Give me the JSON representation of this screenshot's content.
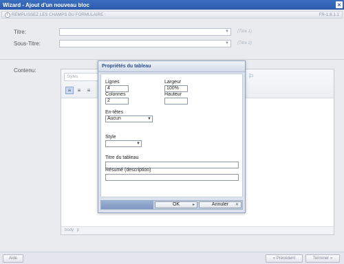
{
  "window": {
    "title": "Wizard - Ajout d'un nouveau bloc",
    "close_icon": "close-icon"
  },
  "strip": {
    "text": "REMPLISSEZ LES CHAMPS DU FORMULAIRE :",
    "version": "FR-1.8.1.1",
    "icon": "info-icon"
  },
  "form": {
    "titre_label": "Titre:",
    "titre_hint": "(Titre 1)",
    "soustitre_label": "Sous-Titre:",
    "soustitre_hint": "(Titre 2)",
    "contenu_label": "Contenu:"
  },
  "editor": {
    "styles_placeholder": "Styles",
    "status": "body p"
  },
  "dialog": {
    "title": "Propriétés du tableau",
    "lignes_label": "Lignes",
    "lignes_value": "4",
    "largeur_label": "Largeur",
    "largeur_value": "100%",
    "colonnes_label": "Colonnes",
    "colonnes_value": "2",
    "hauteur_label": "Hauteur",
    "hauteur_value": "",
    "entetes_label": "En-têtes",
    "entetes_value": "Aucun",
    "style_label": "Style",
    "style_value": "",
    "titre_tableau_label": "Titre du tableau",
    "titre_tableau_value": "",
    "resume_label": "Résumé (description)",
    "resume_value": "",
    "ok_label": "OK",
    "annuler_label": "Annuler"
  },
  "footer": {
    "aide_label": "Aide",
    "precedent_label": "« Précédent",
    "terminer_label": "Terminer »"
  }
}
